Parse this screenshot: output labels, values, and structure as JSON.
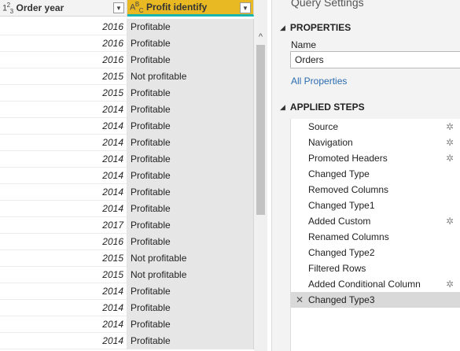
{
  "grid": {
    "columns": [
      {
        "type_glyph": "1²3",
        "name": "Order year"
      },
      {
        "type_glyph": "ᴬᴮC",
        "name": "Profit identify"
      }
    ],
    "rows": [
      {
        "year": "2016",
        "profit": "Profitable"
      },
      {
        "year": "2016",
        "profit": "Profitable"
      },
      {
        "year": "2016",
        "profit": "Profitable"
      },
      {
        "year": "2015",
        "profit": "Not profitable"
      },
      {
        "year": "2015",
        "profit": "Profitable"
      },
      {
        "year": "2014",
        "profit": "Profitable"
      },
      {
        "year": "2014",
        "profit": "Profitable"
      },
      {
        "year": "2014",
        "profit": "Profitable"
      },
      {
        "year": "2014",
        "profit": "Profitable"
      },
      {
        "year": "2014",
        "profit": "Profitable"
      },
      {
        "year": "2014",
        "profit": "Profitable"
      },
      {
        "year": "2014",
        "profit": "Profitable"
      },
      {
        "year": "2017",
        "profit": "Profitable"
      },
      {
        "year": "2016",
        "profit": "Profitable"
      },
      {
        "year": "2015",
        "profit": "Not profitable"
      },
      {
        "year": "2015",
        "profit": "Not profitable"
      },
      {
        "year": "2014",
        "profit": "Profitable"
      },
      {
        "year": "2014",
        "profit": "Profitable"
      },
      {
        "year": "2014",
        "profit": "Profitable"
      },
      {
        "year": "2014",
        "profit": "Profitable"
      }
    ]
  },
  "panel": {
    "title": "Query Settings",
    "properties_header": "PROPERTIES",
    "name_label": "Name",
    "name_value": "Orders",
    "all_properties_link": "All Properties",
    "applied_steps_header": "APPLIED STEPS",
    "steps": [
      {
        "label": "Source",
        "has_gear": true
      },
      {
        "label": "Navigation",
        "has_gear": true
      },
      {
        "label": "Promoted Headers",
        "has_gear": true
      },
      {
        "label": "Changed Type",
        "has_gear": false
      },
      {
        "label": "Removed Columns",
        "has_gear": false
      },
      {
        "label": "Changed Type1",
        "has_gear": false
      },
      {
        "label": "Added Custom",
        "has_gear": true
      },
      {
        "label": "Renamed Columns",
        "has_gear": false
      },
      {
        "label": "Changed Type2",
        "has_gear": false
      },
      {
        "label": "Filtered Rows",
        "has_gear": false
      },
      {
        "label": "Added Conditional Column",
        "has_gear": true
      },
      {
        "label": "Changed Type3",
        "has_gear": false,
        "selected": true
      }
    ]
  },
  "icons": {
    "dropdown": "chevron-down-icon",
    "gear": "gear-icon",
    "delete": "close-icon",
    "collapse": "triangle-icon",
    "scroll_up": "scroll-up-icon"
  },
  "colors": {
    "selected_column_header": "#e8b923",
    "selected_column_underline": "#17b4b0",
    "link": "#2b6cb0"
  }
}
